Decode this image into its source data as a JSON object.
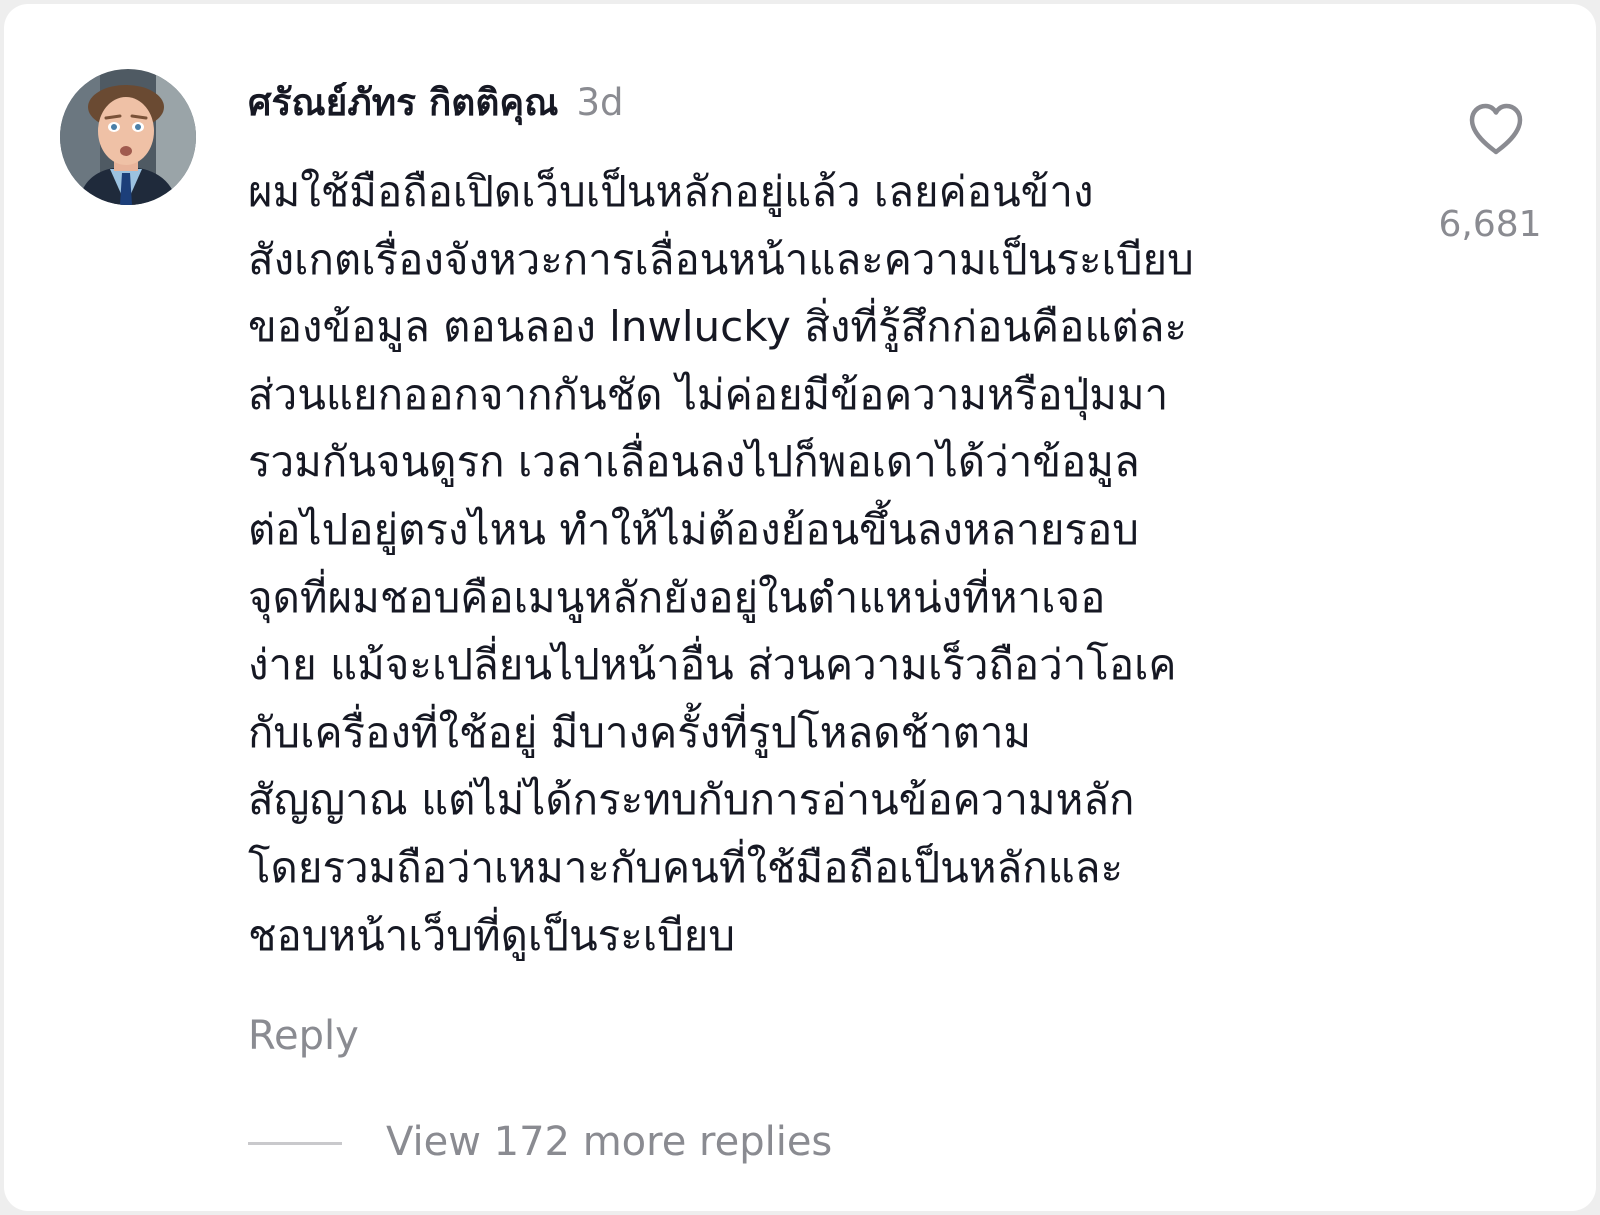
{
  "comment": {
    "author": "ศรัณย์ภัทร กิตติคุณ",
    "time": "3d",
    "lines": [
      "ผมใช้มือถือเปิดเว็บเป็นหลักอยู่แล้ว เลยค่อนข้าง",
      "สังเกตเรื่องจังหวะการเลื่อนหน้าและความเป็นระเบียบ",
      "ของข้อมูล ตอนลอง lnwlucky สิ่งที่รู้สึกก่อนคือแต่ละ",
      "ส่วนแยกออกจากกันชัด ไม่ค่อยมีข้อความหรือปุ่มมา",
      "รวมกันจนดูรก เวลาเลื่อนลงไปก็พอเดาได้ว่าข้อมูล",
      "ต่อไปอยู่ตรงไหน ทำให้ไม่ต้องย้อนขึ้นลงหลายรอบ",
      "จุดที่ผมชอบคือเมนูหลักยังอยู่ในตำแหน่งที่หาเจอ",
      "ง่าย แม้จะเปลี่ยนไปหน้าอื่น ส่วนความเร็วถือว่าโอเค",
      "กับเครื่องที่ใช้อยู่ มีบางครั้งที่รูปโหลดช้าตาม",
      "สัญญาณ แต่ไม่ได้กระทบกับการอ่านข้อความหลัก",
      "โดยรวมถือว่าเหมาะกับคนที่ใช้มือถือเป็นหลักและ",
      "ชอบหน้าเว็บที่ดูเป็นระเบียบ"
    ],
    "like_icon": "heart-outline-icon",
    "like_count": "6,681",
    "reply_label": "Reply",
    "view_replies_label": "View 172 more replies"
  },
  "colors": {
    "text_primary": "#161823",
    "text_secondary": "#8a8b91",
    "background": "#ffffff"
  }
}
